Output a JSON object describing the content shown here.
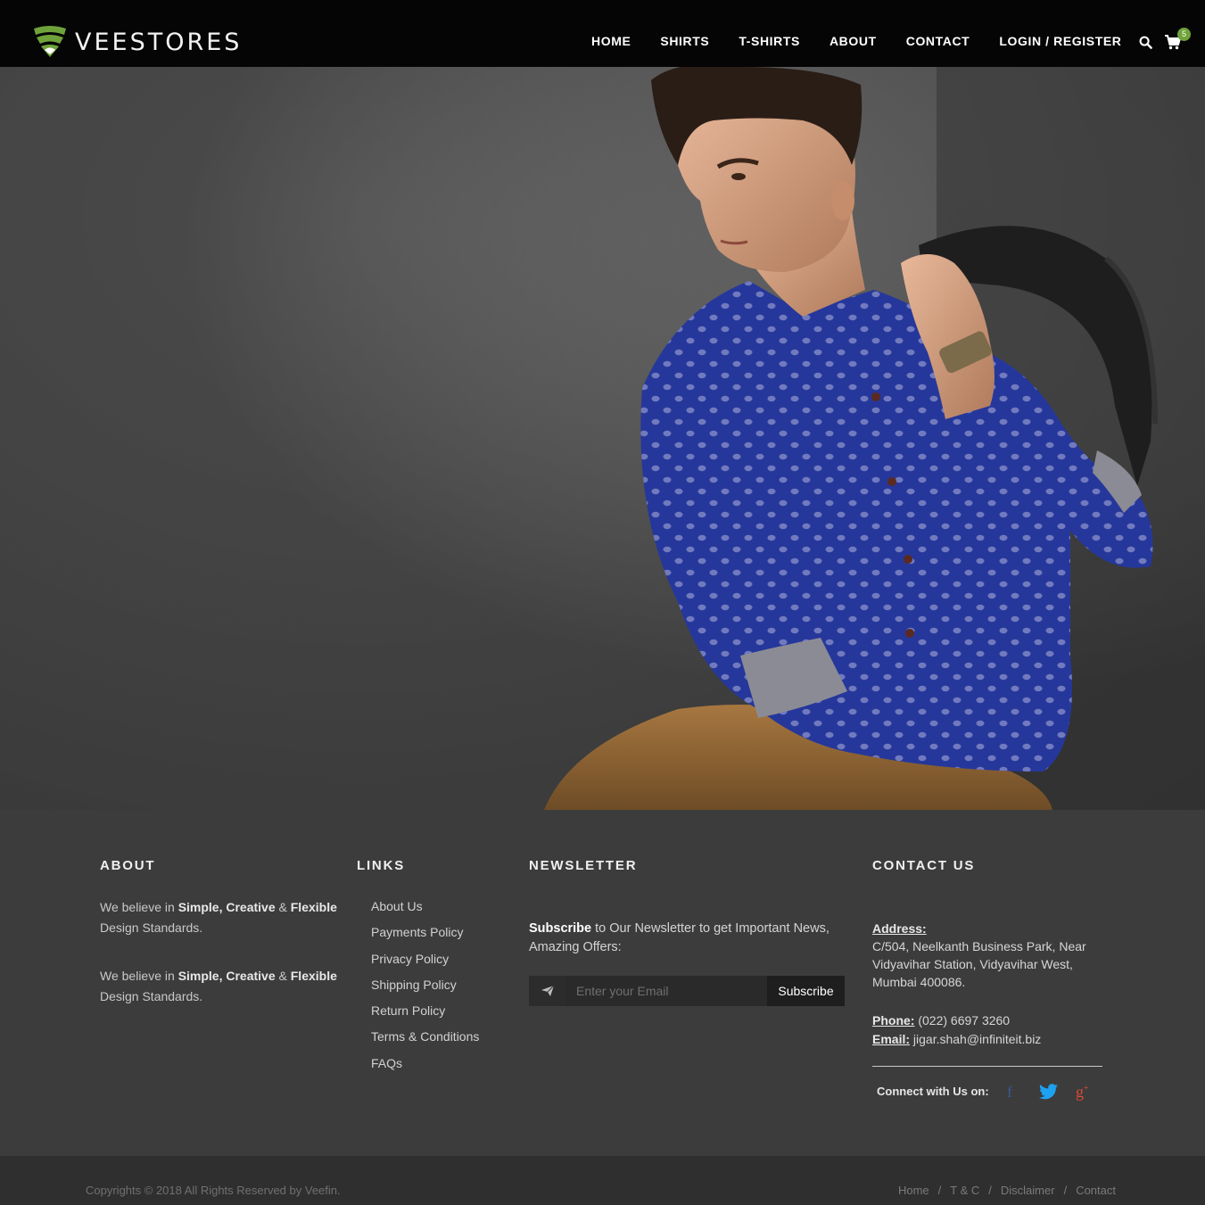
{
  "brand": {
    "name": "VEESTORES",
    "accent_color": "#6fa33a"
  },
  "nav": {
    "items": [
      "HOME",
      "SHIRTS",
      "T-SHIRTS",
      "ABOUT",
      "CONTACT",
      "LOGIN / REGISTER"
    ],
    "search_icon": "search-icon",
    "cart_icon": "cart-icon",
    "cart_count": "5"
  },
  "hero": {
    "image": "man in blue polka-dot shirt holding bag over shoulder"
  },
  "footer": {
    "about": {
      "title": "ABOUT",
      "p1_a": "We believe in ",
      "p1_b": "Simple, Creative",
      "p1_c": " & ",
      "p1_d": "Flexible",
      "p1_e": " Design Standards.",
      "p2_a": "We believe in ",
      "p2_b": "Simple, Creative",
      "p2_c": " & ",
      "p2_d": "Flexible",
      "p2_e": " Design Standards."
    },
    "links": {
      "title": "LINKS",
      "items": [
        "About Us",
        "Payments Policy",
        "Privacy Policy",
        "Shipping Policy",
        "Return Policy",
        "Terms & Conditions",
        "FAQs"
      ]
    },
    "newsletter": {
      "title": "NEWSLETTER",
      "text_bold": "Subscribe",
      "text_rest": " to Our Newsletter to get Important News, Amazing Offers:",
      "placeholder": "Enter your Email",
      "button": "Subscribe",
      "icon": "paper-plane-icon"
    },
    "contact": {
      "title": "CONTACT US",
      "address_label": "Address:",
      "address": "C/504, Neelkanth Business Park, Near Vidyavihar Station, Vidyavihar West, Mumbai 400086.",
      "phone_label": "Phone:",
      "phone": " (022) 6697 3260",
      "email_label": "Email:",
      "email": " jigar.shah@infiniteit.biz",
      "connect_label": "Connect with Us on:",
      "social": [
        {
          "name": "facebook",
          "glyph": "f",
          "color": "#3b5998"
        },
        {
          "name": "twitter",
          "glyph": "twitter",
          "color": "#1da1f2"
        },
        {
          "name": "google-plus",
          "glyph": "g+",
          "color": "#dd4b39"
        }
      ]
    }
  },
  "bottom": {
    "copyright": "Copyrights © 2018 All Rights Reserved by Veefin.",
    "links": [
      "Home",
      "T & C",
      "Disclaimer",
      "Contact"
    ]
  }
}
